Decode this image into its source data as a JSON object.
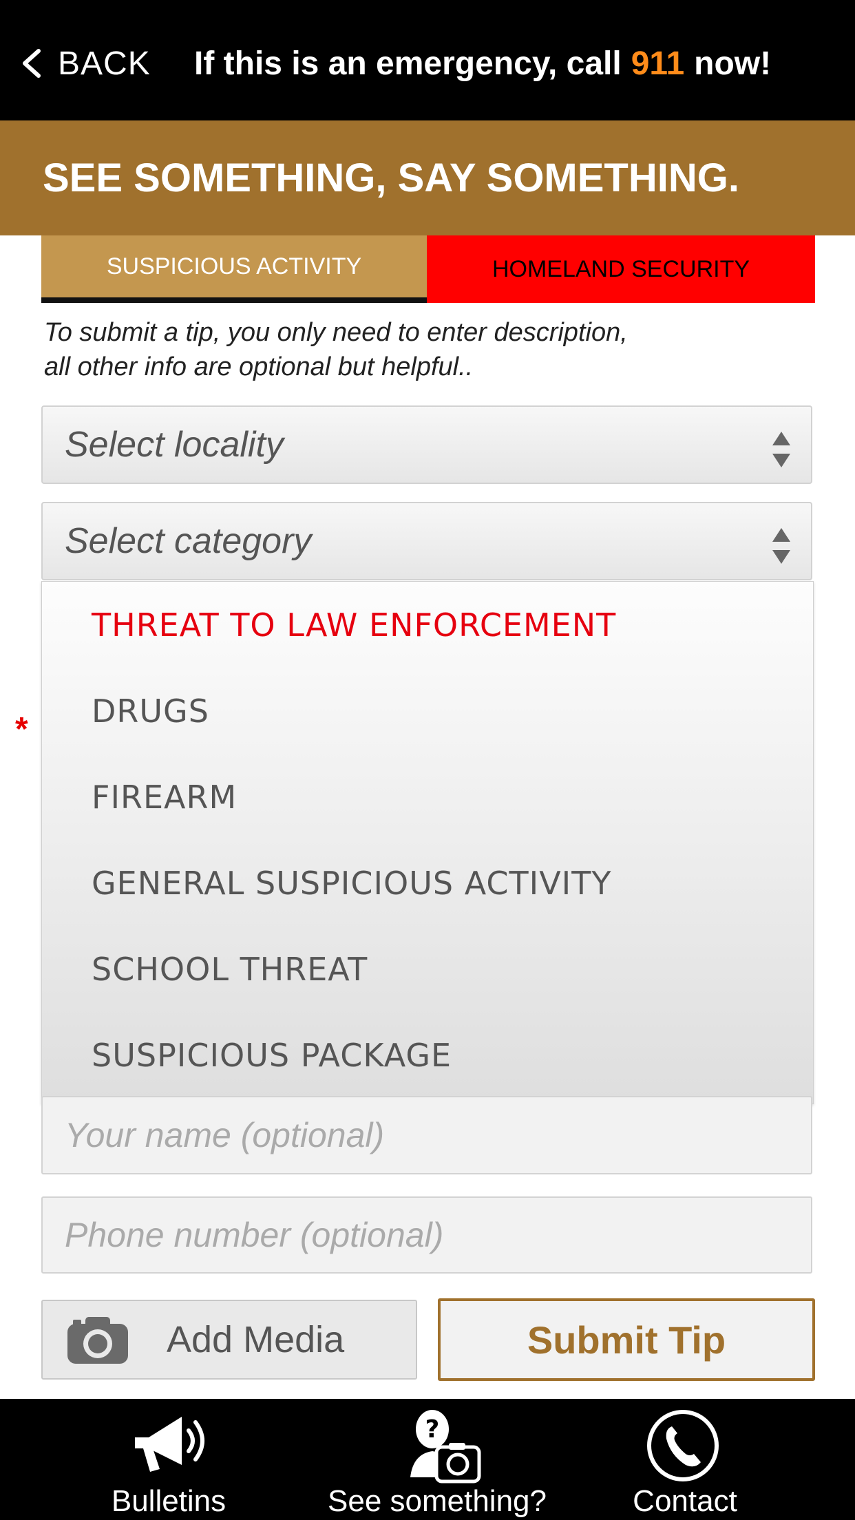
{
  "header": {
    "back_label": "BACK",
    "emergency_prefix": "If this is an emergency, call",
    "emergency_number": "911",
    "emergency_suffix": "now!"
  },
  "banner": {
    "title": "SEE SOMETHING, SAY SOMETHING."
  },
  "tabs": [
    {
      "label": "SUSPICIOUS ACTIVITY",
      "active": true
    },
    {
      "label": "HOMELAND SECURITY",
      "active": false
    }
  ],
  "hint": {
    "line1": "To submit a tip, you only need to enter description,",
    "line2": "all other info are optional but helpful.."
  },
  "form": {
    "locality_select": "Select locality",
    "category_select": "Select category",
    "required_marker": "*",
    "category_options": [
      {
        "label": "THREAT TO LAW ENFORCEMENT",
        "selected": true
      },
      {
        "label": "DRUGS",
        "selected": false
      },
      {
        "label": "FIREARM",
        "selected": false
      },
      {
        "label": "GENERAL SUSPICIOUS ACTIVITY",
        "selected": false
      },
      {
        "label": "SCHOOL THREAT",
        "selected": false
      },
      {
        "label": "SUSPICIOUS PACKAGE",
        "selected": false
      }
    ],
    "name_placeholder": "Your name (optional)",
    "phone_placeholder": "Phone number (optional)",
    "add_media_label": "Add Media",
    "submit_label": "Submit Tip"
  },
  "tabbar": [
    {
      "label": "Bulletins",
      "icon": "megaphone-icon"
    },
    {
      "label": "See something?",
      "icon": "question-camera-icon"
    },
    {
      "label": "Contact",
      "icon": "phone-icon"
    }
  ],
  "colors": {
    "brand_gold": "#a0712d",
    "tab_gold": "#c4974f",
    "alert_red": "#ff0000",
    "emergency_orange": "#ff8c1a"
  }
}
